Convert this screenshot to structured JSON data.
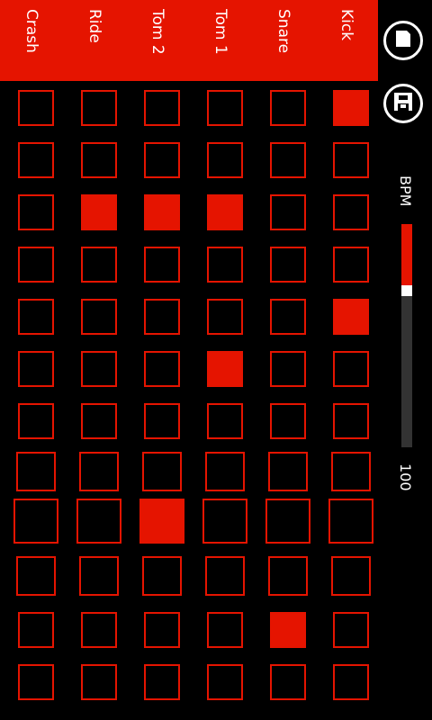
{
  "header": {
    "tracks": [
      "Crash",
      "Ride",
      "Tom 2",
      "Tom 1",
      "Snare",
      "Kick"
    ]
  },
  "toolbar": {
    "stop_icon": "stop-icon",
    "save_icon": "save-icon"
  },
  "bpm": {
    "label": "BPM",
    "value": "100",
    "level": 0.29
  },
  "colors": {
    "accent": "#e51400",
    "background": "#000000",
    "track": "#333333"
  },
  "pattern": [
    [
      0,
      0,
      0,
      0,
      0,
      1
    ],
    [
      0,
      0,
      0,
      0,
      0,
      0
    ],
    [
      0,
      1,
      1,
      1,
      0,
      0
    ],
    [
      0,
      0,
      0,
      0,
      0,
      0
    ],
    [
      0,
      0,
      0,
      0,
      0,
      1
    ],
    [
      0,
      0,
      0,
      1,
      0,
      0
    ],
    [
      0,
      0,
      0,
      0,
      0,
      0
    ],
    [
      0,
      0,
      0,
      0,
      0,
      0
    ],
    [
      0,
      0,
      1,
      0,
      0,
      0
    ],
    [
      0,
      0,
      0,
      0,
      0,
      0
    ],
    [
      0,
      0,
      0,
      0,
      1,
      0
    ],
    [
      0,
      0,
      0,
      0,
      0,
      0
    ]
  ]
}
